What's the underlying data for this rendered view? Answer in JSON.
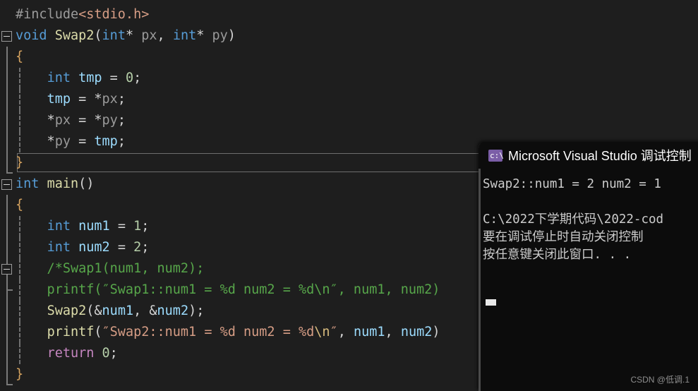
{
  "editor": {
    "name": "visual-studio-code-editor",
    "background_color": "#1e1e1e",
    "current_line_index": 7,
    "lines": [
      {
        "index": 0,
        "fold": "none",
        "guide": false,
        "bar": "none",
        "tokens": [
          {
            "cls": "pp",
            "t": "#include"
          },
          {
            "cls": "hdr",
            "t": "<stdio.h>"
          }
        ],
        "text": "#include<stdio.h>"
      },
      {
        "index": 1,
        "fold": "minus",
        "guide": false,
        "bar": "none",
        "tokens": [
          {
            "cls": "kw",
            "t": "void"
          },
          {
            "cls": "plain",
            "t": " "
          },
          {
            "cls": "fn",
            "t": "Swap2"
          },
          {
            "cls": "op",
            "t": "("
          },
          {
            "cls": "kw",
            "t": "int"
          },
          {
            "cls": "op",
            "t": "* "
          },
          {
            "cls": "id",
            "t": "px"
          },
          {
            "cls": "op",
            "t": ", "
          },
          {
            "cls": "kw",
            "t": "int"
          },
          {
            "cls": "op",
            "t": "* "
          },
          {
            "cls": "id",
            "t": "py"
          },
          {
            "cls": "op",
            "t": ")"
          }
        ],
        "text": "void Swap2(int* px, int* py)"
      },
      {
        "index": 2,
        "fold": "none",
        "guide": false,
        "bar": "line",
        "tokens": [
          {
            "cls": "brc",
            "t": "{"
          }
        ],
        "text": "{"
      },
      {
        "index": 3,
        "fold": "none",
        "guide": true,
        "bar": "line",
        "tokens": [
          {
            "cls": "plain",
            "t": "    "
          },
          {
            "cls": "kw",
            "t": "int"
          },
          {
            "cls": "plain",
            "t": " "
          },
          {
            "cls": "var",
            "t": "tmp"
          },
          {
            "cls": "op",
            "t": " = "
          },
          {
            "cls": "num",
            "t": "0"
          },
          {
            "cls": "op",
            "t": ";"
          }
        ],
        "text": "    int tmp = 0;"
      },
      {
        "index": 4,
        "fold": "none",
        "guide": true,
        "bar": "line",
        "tokens": [
          {
            "cls": "plain",
            "t": "    "
          },
          {
            "cls": "var",
            "t": "tmp"
          },
          {
            "cls": "op",
            "t": " = *"
          },
          {
            "cls": "id",
            "t": "px"
          },
          {
            "cls": "op",
            "t": ";"
          }
        ],
        "text": "    tmp = *px;"
      },
      {
        "index": 5,
        "fold": "none",
        "guide": true,
        "bar": "line",
        "tokens": [
          {
            "cls": "op",
            "t": "    *"
          },
          {
            "cls": "id",
            "t": "px"
          },
          {
            "cls": "op",
            "t": " = *"
          },
          {
            "cls": "id",
            "t": "py"
          },
          {
            "cls": "op",
            "t": ";"
          }
        ],
        "text": "    *px = *py;"
      },
      {
        "index": 6,
        "fold": "none",
        "guide": true,
        "bar": "line",
        "tokens": [
          {
            "cls": "op",
            "t": "    *"
          },
          {
            "cls": "id",
            "t": "py"
          },
          {
            "cls": "op",
            "t": " = "
          },
          {
            "cls": "var",
            "t": "tmp"
          },
          {
            "cls": "op",
            "t": ";"
          }
        ],
        "text": "    *py = tmp;"
      },
      {
        "index": 7,
        "fold": "none",
        "guide": false,
        "bar": "endcap",
        "tokens": [
          {
            "cls": "brc",
            "t": "}"
          }
        ],
        "text": "}"
      },
      {
        "index": 8,
        "fold": "minus",
        "guide": false,
        "bar": "none",
        "tokens": [
          {
            "cls": "kw",
            "t": "int"
          },
          {
            "cls": "plain",
            "t": " "
          },
          {
            "cls": "fn",
            "t": "main"
          },
          {
            "cls": "op",
            "t": "()"
          }
        ],
        "text": "int main()"
      },
      {
        "index": 9,
        "fold": "none",
        "guide": false,
        "bar": "line",
        "tokens": [
          {
            "cls": "brc",
            "t": "{"
          }
        ],
        "text": "{"
      },
      {
        "index": 10,
        "fold": "none",
        "guide": true,
        "bar": "line",
        "tokens": [
          {
            "cls": "plain",
            "t": "    "
          },
          {
            "cls": "kw",
            "t": "int"
          },
          {
            "cls": "plain",
            "t": " "
          },
          {
            "cls": "var",
            "t": "num1"
          },
          {
            "cls": "op",
            "t": " = "
          },
          {
            "cls": "num",
            "t": "1"
          },
          {
            "cls": "op",
            "t": ";"
          }
        ],
        "text": "    int num1 = 1;"
      },
      {
        "index": 11,
        "fold": "none",
        "guide": true,
        "bar": "line",
        "tokens": [
          {
            "cls": "plain",
            "t": "    "
          },
          {
            "cls": "kw",
            "t": "int"
          },
          {
            "cls": "plain",
            "t": " "
          },
          {
            "cls": "var",
            "t": "num2"
          },
          {
            "cls": "op",
            "t": " = "
          },
          {
            "cls": "num",
            "t": "2"
          },
          {
            "cls": "op",
            "t": ";"
          }
        ],
        "text": "    int num2 = 2;"
      },
      {
        "index": 12,
        "fold": "minus",
        "guide": true,
        "bar": "line",
        "tokens": [
          {
            "cls": "cmt",
            "t": "    /*Swap1(num1, num2);"
          }
        ],
        "text": "    /*Swap1(num1, num2);"
      },
      {
        "index": 13,
        "fold": "none",
        "guide": true,
        "bar": "tick",
        "tokens": [
          {
            "cls": "cmt",
            "t": "    printf(″Swap1::num1 = %d num2 = %d\\n″, num1, num2)"
          }
        ],
        "text": "    printf(″Swap1::num1 = %d num2 = %d\\n″, num1, num2)"
      },
      {
        "index": 14,
        "fold": "none",
        "guide": true,
        "bar": "line",
        "tokens": [
          {
            "cls": "plain",
            "t": "    "
          },
          {
            "cls": "fn",
            "t": "Swap2"
          },
          {
            "cls": "op",
            "t": "(&"
          },
          {
            "cls": "var",
            "t": "num1"
          },
          {
            "cls": "op",
            "t": ", &"
          },
          {
            "cls": "var",
            "t": "num2"
          },
          {
            "cls": "op",
            "t": ");"
          }
        ],
        "text": "    Swap2(&num1, &num2);"
      },
      {
        "index": 15,
        "fold": "none",
        "guide": true,
        "bar": "line",
        "tokens": [
          {
            "cls": "plain",
            "t": "    "
          },
          {
            "cls": "fn",
            "t": "printf"
          },
          {
            "cls": "op",
            "t": "("
          },
          {
            "cls": "str",
            "t": "″Swap2::num1 = %d num2 = %d"
          },
          {
            "cls": "esc",
            "t": "\\n"
          },
          {
            "cls": "str",
            "t": "″"
          },
          {
            "cls": "op",
            "t": ", "
          },
          {
            "cls": "var",
            "t": "num1"
          },
          {
            "cls": "op",
            "t": ", "
          },
          {
            "cls": "var",
            "t": "num2"
          },
          {
            "cls": "op",
            "t": ")"
          }
        ],
        "text": "    printf(″Swap2::num1 = %d num2 = %d\\n″, num1, num2)"
      },
      {
        "index": 16,
        "fold": "none",
        "guide": true,
        "bar": "line",
        "tokens": [
          {
            "cls": "plain",
            "t": "    "
          },
          {
            "cls": "ctl",
            "t": "return"
          },
          {
            "cls": "plain",
            "t": " "
          },
          {
            "cls": "num",
            "t": "0"
          },
          {
            "cls": "op",
            "t": ";"
          }
        ],
        "text": "    return 0;"
      },
      {
        "index": 17,
        "fold": "none",
        "guide": false,
        "bar": "endcap",
        "tokens": [
          {
            "cls": "brc",
            "t": "}"
          }
        ],
        "text": "}"
      }
    ]
  },
  "console": {
    "name": "debug-console-window",
    "icon": "console-app-icon",
    "icon_glyph": "c:\\",
    "title": "Microsoft Visual Studio 调试控制",
    "background_color": "#0c0c0c",
    "lines": [
      "Swap2::num1 = 2 num2 = 1",
      "",
      "C:\\2022下学期代码\\2022-cod",
      "要在调试停止时自动关闭控制",
      "按任意键关闭此窗口. . ."
    ],
    "line_output": "Swap2::num1 = 2 num2 = 1",
    "line_path": "C:\\2022下学期代码\\2022-cod",
    "line_hint1": "要在调试停止时自动关闭控制",
    "line_hint2": "按任意键关闭此窗口. . ."
  },
  "watermark": {
    "text": "CSDN @低调.1"
  }
}
